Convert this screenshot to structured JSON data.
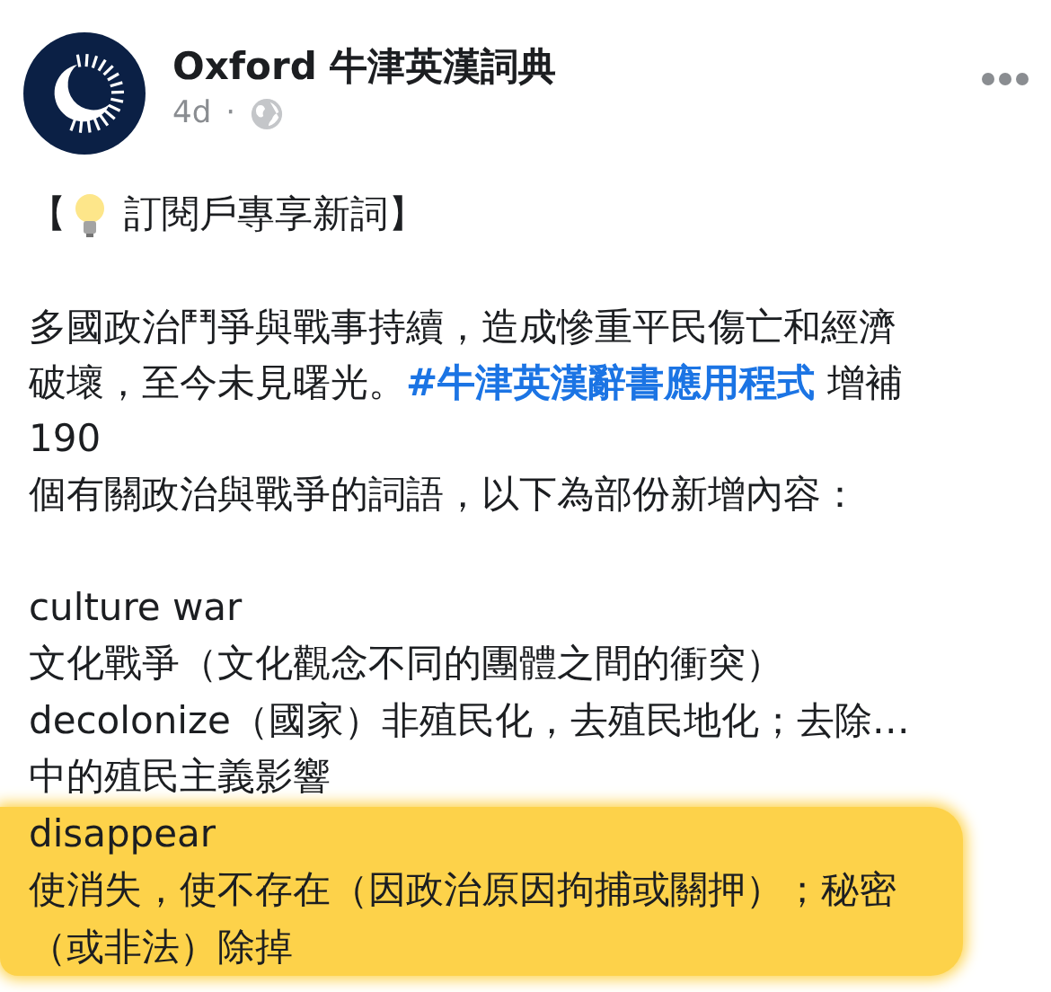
{
  "post": {
    "author": "Oxford 牛津英漢詞典",
    "time": "4d",
    "separator": "·",
    "title": {
      "open": "【",
      "close": "訂閱戶專享新詞】"
    },
    "paragraph": [
      {
        "text": "多國政治鬥爭與戰事持續，造成慘重平民傷亡和經濟"
      },
      {
        "text": "破壞，至今未見曙光。",
        "hashtag": "#牛津英漢辭書應用程式",
        "after": " 增補"
      },
      {
        "text": "190"
      },
      {
        "text": "個有關政治與戰爭的詞語，以下為部份新增內容："
      }
    ],
    "entries": [
      {
        "kind": "stacked",
        "word": "culture war",
        "definition": [
          "文化戰爭（文化觀念不同的團體之間的衝突）"
        ],
        "highlighted": false
      },
      {
        "kind": "inline",
        "word": "decolonize",
        "definition": [
          "（國家）非殖民化，去殖民地化；去除…",
          "中的殖民主義影響"
        ],
        "highlighted": false
      },
      {
        "kind": "stacked",
        "word": "disappear",
        "definition": [
          "使消失，使不存在（因政治原因拘捕或關押）；秘密",
          "（或非法）除掉"
        ],
        "highlighted": true
      }
    ]
  }
}
